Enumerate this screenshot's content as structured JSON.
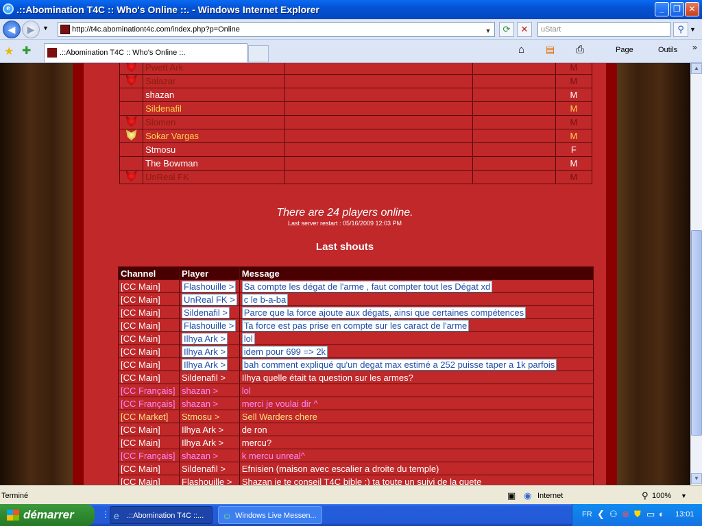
{
  "window": {
    "title": ".::Abomination T4C :: Who's Online ::. - Windows Internet Explorer",
    "minimize": "_",
    "maximize": "❐",
    "close": "✕"
  },
  "address_bar": {
    "url": "http://t4c.abominationt4c.com/index.php?p=Online",
    "search_placeholder": "uStart",
    "back": "◀",
    "forward": "▶"
  },
  "tabs": [
    {
      "label": ".::Abomination T4C :: Who's Online ::."
    }
  ],
  "command_bar": {
    "home": "⌂",
    "feeds": "▤",
    "print": "⎙",
    "page": "Page",
    "tools": "Outils",
    "more": "»"
  },
  "players": [
    {
      "name": "Pwett Ark",
      "sex": "M",
      "icon": "red",
      "color": "dark"
    },
    {
      "name": "Salazar",
      "sex": "M",
      "icon": "red",
      "color": "dark"
    },
    {
      "name": "shazan",
      "sex": "M",
      "icon": "none",
      "color": "white"
    },
    {
      "name": "Sildenafil",
      "sex": "M",
      "icon": "none",
      "color": "gold"
    },
    {
      "name": "Slomen",
      "sex": "M",
      "icon": "red",
      "color": "dark"
    },
    {
      "name": "Sokar Vargas",
      "sex": "M",
      "icon": "gold",
      "color": "gold"
    },
    {
      "name": "Stmosu",
      "sex": "F",
      "icon": "none",
      "color": "white"
    },
    {
      "name": "The Bowman",
      "sex": "M",
      "icon": "none",
      "color": "white"
    },
    {
      "name": "UnReal FK",
      "sex": "M",
      "icon": "red",
      "color": "dark"
    }
  ],
  "online": {
    "count_text": "There are 24 players online.",
    "restart_text": "Last server restart : 05/16/2009 12:03 PM"
  },
  "shouts": {
    "title": "Last shouts",
    "headers": [
      "Channel",
      "Player",
      "Message"
    ],
    "rows": [
      {
        "channel": "[CC Main]",
        "player": "Flashouille >",
        "message": "Sa compte les dégat de l'arme , faut compter tout les Dégat xd",
        "style": "hl"
      },
      {
        "channel": "[CC Main]",
        "player": "UnReal FK >",
        "message": "c le b-a-ba",
        "style": "hl"
      },
      {
        "channel": "[CC Main]",
        "player": "Sildenafil >",
        "message": "Parce que la force ajoute aux dégats, ainsi que certaines compétences",
        "style": "hl"
      },
      {
        "channel": "[CC Main]",
        "player": "Flashouille >",
        "message": "Ta force est pas prise en compte sur les caract de l'arme",
        "style": "hl"
      },
      {
        "channel": "[CC Main]",
        "player": "Ilhya Ark >",
        "message": "lol",
        "style": "hl"
      },
      {
        "channel": "[CC Main]",
        "player": "Ilhya Ark >",
        "message": "idem pour 699 => 2k",
        "style": "hl"
      },
      {
        "channel": "[CC Main]",
        "player": "Ilhya Ark >",
        "message": "bah comment expliqué qu'un degat max estimé a 252 puisse taper a 1k parfois",
        "style": "hl"
      },
      {
        "channel": "[CC Main]",
        "player": "Sildenafil >",
        "message": "Ilhya quelle était ta question sur les armes?",
        "style": "main"
      },
      {
        "channel": "[CC Français]",
        "player": "shazan >",
        "message": "lol",
        "style": "fr"
      },
      {
        "channel": "[CC Français]",
        "player": "shazan >",
        "message": "merci je voulai dir ^",
        "style": "fr"
      },
      {
        "channel": "[CC Market]",
        "player": "Stmosu >",
        "message": "Sell Warders chere",
        "style": "market"
      },
      {
        "channel": "[CC Main]",
        "player": "Ilhya Ark >",
        "message": "de ron",
        "style": "main"
      },
      {
        "channel": "[CC Main]",
        "player": "Ilhya Ark >",
        "message": "mercu?",
        "style": "main"
      },
      {
        "channel": "[CC Français]",
        "player": "shazan >",
        "message": "k mercu unreal^",
        "style": "fr"
      },
      {
        "channel": "[CC Main]",
        "player": "Sildenafil >",
        "message": "Efnisien (maison avec escalier a droite du temple)",
        "style": "main"
      },
      {
        "channel": "[CC Main]",
        "player": "Flashouille >",
        "message": "Shazan je te conseil T4C bible :) ta toute un suivi de la quete",
        "style": "main"
      }
    ]
  },
  "status_bar": {
    "status": "Terminé",
    "zone": "Internet",
    "zoom": "100%"
  },
  "taskbar": {
    "start": "démarrer",
    "tasks": [
      ".::Abomination T4C ::...",
      "Windows Live Messen..."
    ],
    "lang": "FR",
    "clock": "13:01"
  },
  "colors": {
    "page_bg": "#c0282a",
    "highlight_text": "#1f4fa8",
    "french_channel": "#ff88ff",
    "market_channel": "#ffe080"
  }
}
